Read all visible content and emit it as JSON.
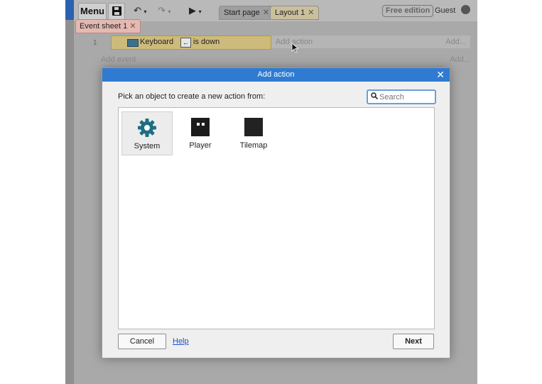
{
  "toolbar": {
    "menu_label": "Menu",
    "tabs": [
      {
        "label": "Start page"
      },
      {
        "label": "Layout 1"
      }
    ],
    "edition_label": "Free edition",
    "user_label": "Guest"
  },
  "event_sheet": {
    "tab_label": "Event sheet 1",
    "events": [
      {
        "number": "1",
        "condition_object": "Keyboard",
        "condition_text": "is down",
        "add_action_label": "Add action",
        "add_right_label": "Add..."
      }
    ],
    "add_event_label": "Add event",
    "add_right_label": "Add..."
  },
  "dialog": {
    "title": "Add action",
    "prompt": "Pick an object to create a new action from:",
    "search_placeholder": "Search",
    "objects": [
      {
        "label": "System",
        "selected": true
      },
      {
        "label": "Player",
        "selected": false
      },
      {
        "label": "Tilemap",
        "selected": false
      }
    ],
    "cancel_label": "Cancel",
    "help_label": "Help",
    "next_label": "Next"
  },
  "colors": {
    "dialog_title_bg": "#2f7bd1",
    "system_icon": "#1f6f84",
    "condition_bg": "#cdbb7c",
    "sheet_tab_bg": "#e3b9b2"
  },
  "icons": [
    "save-icon",
    "undo-icon",
    "redo-icon",
    "play-icon",
    "close-icon",
    "keyboard-icon",
    "arrow-left-icon",
    "gear-icon",
    "search-icon",
    "user-icon",
    "mouse-cursor-icon"
  ]
}
